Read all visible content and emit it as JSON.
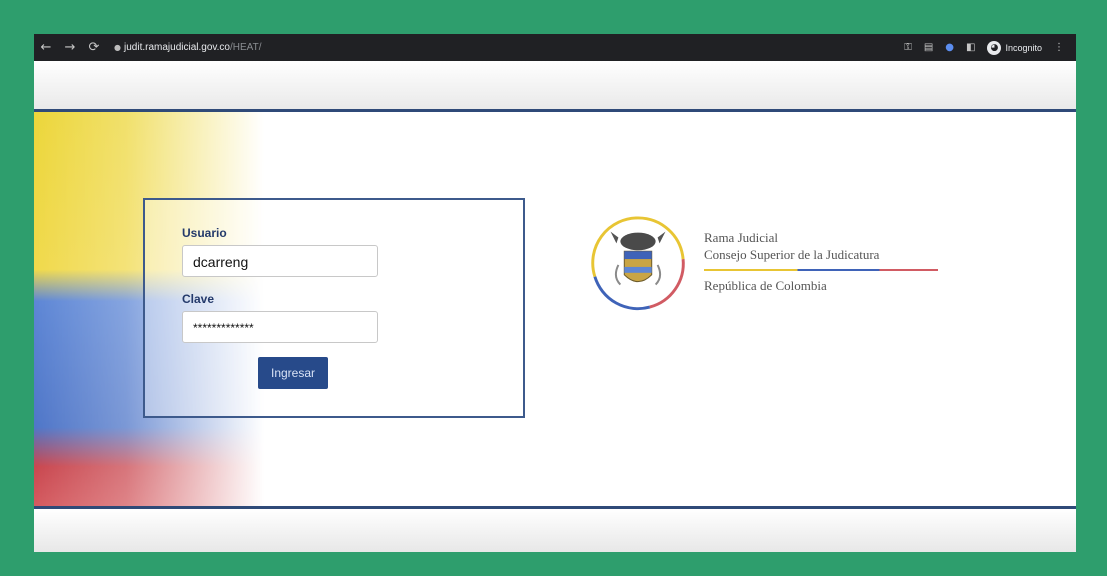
{
  "browser": {
    "url_host": "judit.ramajudicial.gov.co",
    "url_path": "/HEAT/",
    "profile_label": "Incognito",
    "icons": [
      "back-icon",
      "forward-icon",
      "reload-icon",
      "lock-icon",
      "key-icon",
      "translate-icon",
      "extension-icon",
      "sidepanel-icon",
      "incognito-icon",
      "menu-icon"
    ]
  },
  "login": {
    "user_label": "Usuario",
    "user_value": "dcarreng",
    "password_label": "Clave",
    "password_value": "*************",
    "submit_label": "Ingresar"
  },
  "institution": {
    "line1": "Rama Judicial",
    "line2": "Consejo Superior de la Judicatura",
    "line3": "República de Colombia"
  },
  "colors": {
    "frame": "#2e9e6d",
    "accent_blue": "#2f4a78",
    "button": "#274a8a",
    "flag_yellow": "#ecd63a",
    "flag_blue": "#4f76c8",
    "flag_red": "#c9474f"
  }
}
